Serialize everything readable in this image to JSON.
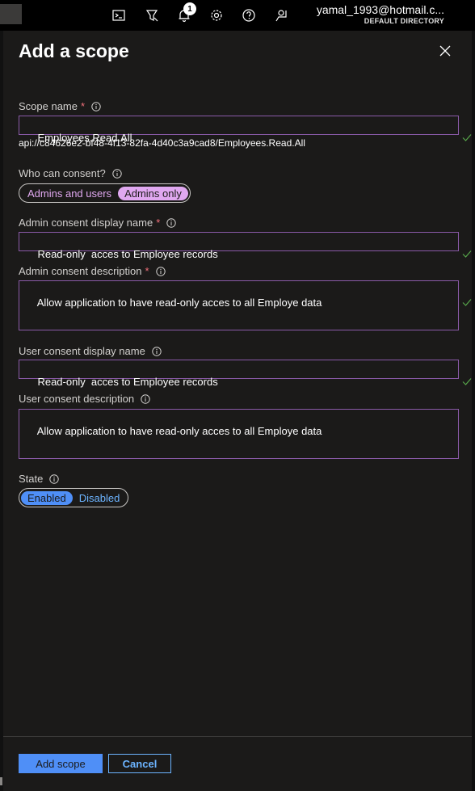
{
  "topbar": {
    "notification_count": "1",
    "account_email": "yamal_1993@hotmail.c...",
    "account_directory": "DEFAULT DIRECTORY",
    "icons": [
      "cloud-shell-icon",
      "directory-filter-icon",
      "notifications-icon",
      "settings-icon",
      "help-icon",
      "feedback-icon"
    ]
  },
  "panel": {
    "title": "Add a scope"
  },
  "form": {
    "scope_name": {
      "label": "Scope name",
      "required_mark": "*",
      "value": "Employees.Read.All",
      "uri": "api://c84626e2-bf48-4f13-82fa-4d40c3a9cad8/Employees.Read.All"
    },
    "who_can_consent": {
      "label": "Who can consent?",
      "options": [
        "Admins and users",
        "Admins only"
      ],
      "selected": "Admins only"
    },
    "admin_display_name": {
      "label": "Admin consent display name",
      "required_mark": "*",
      "value": "Read-only  acces to Employee records"
    },
    "admin_description": {
      "label": "Admin consent description",
      "required_mark": "*",
      "value": "Allow application to have read-only acces to all Employe data"
    },
    "user_display_name": {
      "label": "User consent display name",
      "value": "Read-only  acces to Employee records"
    },
    "user_description": {
      "label": "User consent description",
      "value": "Allow application to have read-only acces to all Employe data"
    },
    "state": {
      "label": "State",
      "options": [
        "Enabled",
        "Disabled"
      ],
      "selected": "Enabled"
    }
  },
  "footer": {
    "add_label": "Add scope",
    "cancel_label": "Cancel"
  },
  "colors": {
    "accent_blue": "#4f8ff7",
    "input_border": "#8a5aa8",
    "required": "#f1707b",
    "valid_check": "#57a64a",
    "selected_pill": "#e0a8f0"
  }
}
